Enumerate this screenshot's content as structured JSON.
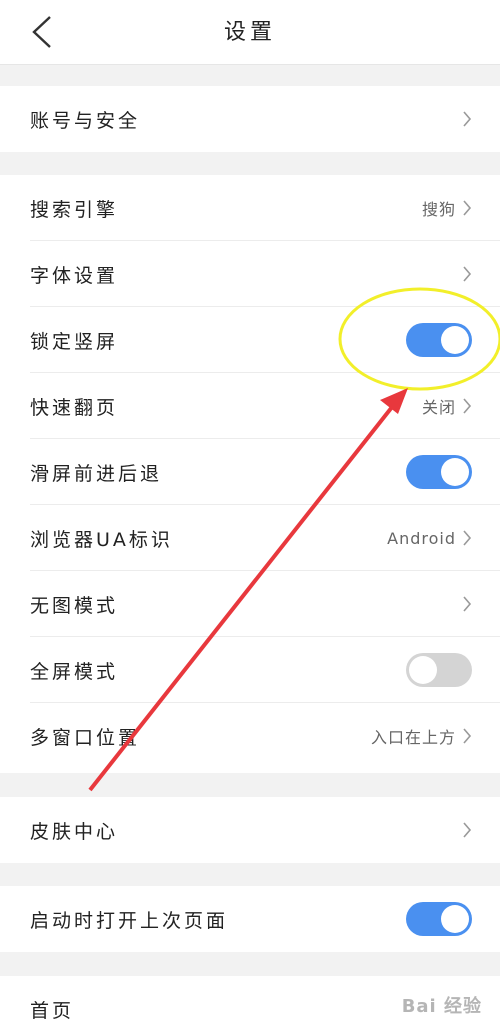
{
  "header": {
    "title": "设置"
  },
  "group1": {
    "items": [
      {
        "label": "账号与安全"
      }
    ]
  },
  "group2": {
    "items": [
      {
        "label": "搜索引擎",
        "value": "搜狗"
      },
      {
        "label": "字体设置"
      },
      {
        "label": "锁定竖屏",
        "toggle": "on"
      },
      {
        "label": "快速翻页",
        "value": "关闭"
      },
      {
        "label": "滑屏前进后退",
        "toggle": "on"
      },
      {
        "label": "浏览器UA标识",
        "value": "Android"
      },
      {
        "label": "无图模式"
      },
      {
        "label": "全屏模式",
        "toggle": "off"
      },
      {
        "label": "多窗口位置",
        "value": "入口在上方"
      }
    ]
  },
  "group3": {
    "items": [
      {
        "label": "皮肤中心"
      }
    ]
  },
  "group4": {
    "items": [
      {
        "label": "启动时打开上次页面",
        "toggle": "on"
      }
    ]
  },
  "group5": {
    "items": [
      {
        "label": "首页"
      }
    ]
  },
  "colors": {
    "toggle_on": "#4a90f0",
    "toggle_off": "#d4d4d4",
    "annotation_arrow": "#e8383d",
    "annotation_circle": "#f2ef2a"
  },
  "watermark": "Bai 经验"
}
